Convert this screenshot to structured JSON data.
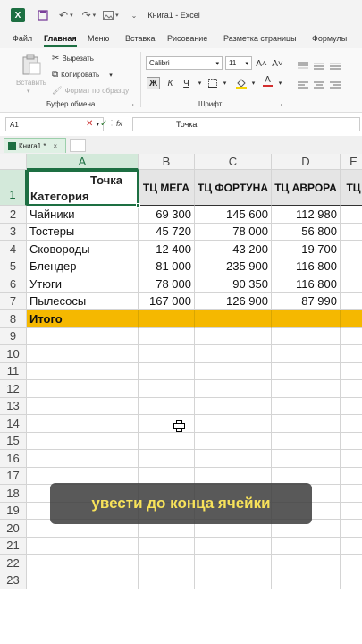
{
  "titlebar": {
    "app_title": "Книга1 - Excel",
    "logo": "X"
  },
  "menu": [
    "Файл",
    "Главная",
    "Меню",
    "Вставка",
    "Рисование",
    "Разметка страницы",
    "Формулы"
  ],
  "ribbon": {
    "paste": "Вставить",
    "cut": "Вырезать",
    "copy": "Копировать",
    "format_painter": "Формат по образцу",
    "clipboard_group": "Буфер обмена",
    "font_name": "Calibri",
    "font_size": "11",
    "font_group": "Шрифт",
    "bold": "Ж",
    "italic": "К",
    "underline": "Ч",
    "grow_font": "A˄",
    "shrink_font": "A˅",
    "font_color_letter": "A"
  },
  "formula_bar": {
    "name_box": "A1",
    "formula": "Точка",
    "fx": "fx",
    "cancel": "✕",
    "confirm": "✓"
  },
  "workbook_tab": {
    "name": "Книга1 *"
  },
  "columns": [
    "A",
    "B",
    "C",
    "D",
    "E"
  ],
  "rows": [
    "1",
    "2",
    "3",
    "4",
    "5",
    "6",
    "7",
    "8",
    "9",
    "10",
    "11",
    "12",
    "13",
    "14",
    "15",
    "16",
    "17",
    "18",
    "19",
    "20",
    "21",
    "22",
    "23"
  ],
  "header_a1": {
    "line1": "Точка",
    "line2": "Категория"
  },
  "header_row": [
    "ТЦ МЕГА",
    "ТЦ ФОРТУНА",
    "ТЦ АВРОРА",
    "ТЦ"
  ],
  "data": [
    [
      "Чайники",
      "69 300",
      "145 600",
      "112 980"
    ],
    [
      "Тостеры",
      "45 720",
      "78 000",
      "56 800"
    ],
    [
      "Сковороды",
      "12 400",
      "43 200",
      "19 700"
    ],
    [
      "Блендер",
      "81 000",
      "235 900",
      "116 800"
    ],
    [
      "Утюги",
      "78 000",
      "90 350",
      "116 800"
    ],
    [
      "Пылесосы",
      "167 000",
      "126 900",
      "87 990"
    ]
  ],
  "total_label": "Итого",
  "caption": "увести до конца ячейки",
  "colors": {
    "accent": "#1d6f42",
    "total_fill": "#f5b800",
    "caption_text": "#f7e25a"
  }
}
